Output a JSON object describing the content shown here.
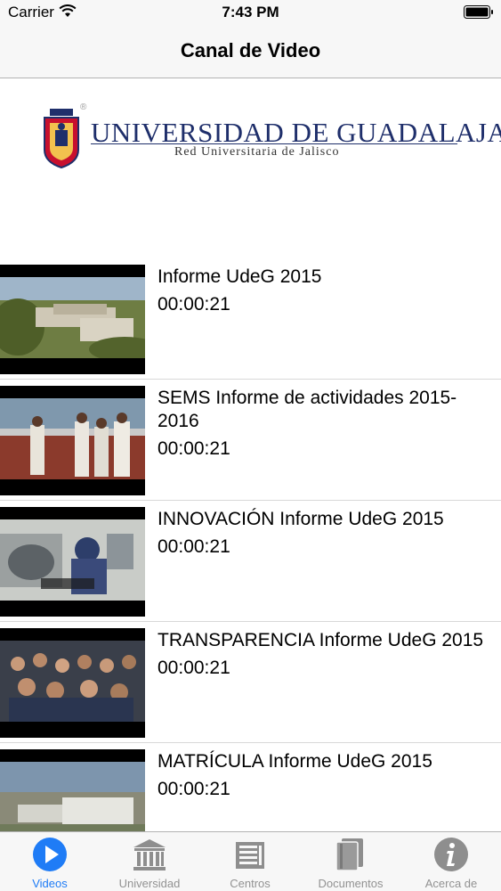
{
  "status_bar": {
    "carrier": "Carrier",
    "time": "7:43 PM"
  },
  "nav": {
    "title": "Canal de Video"
  },
  "logo": {
    "name": "Universidad de Guadalajara",
    "line1": "UNIVERSIDAD DE GUADALAJARA",
    "line2": "Red Universitaria de Jalisco",
    "registered": "®"
  },
  "videos": [
    {
      "title": "Informe UdeG 2015",
      "duration": "00:00:21",
      "thumb": "campus-aerial"
    },
    {
      "title": "SEMS  Informe de actividades 2015-2016",
      "duration": "00:00:21",
      "thumb": "people-standing"
    },
    {
      "title": "INNOVACIÓN Informe UdeG 2015",
      "duration": "00:00:21",
      "thumb": "lab-worker"
    },
    {
      "title": "TRANSPARENCIA Informe  UdeG 2015",
      "duration": "00:00:21",
      "thumb": "crowd-audience"
    },
    {
      "title": "MATRÍCULA Informe UdeG 2015",
      "duration": "00:00:21",
      "thumb": "building-aerial"
    }
  ],
  "tabbar": {
    "items": [
      {
        "label": "Videos",
        "icon": "play-icon",
        "active": true
      },
      {
        "label": "Universidad",
        "icon": "university-icon",
        "active": false
      },
      {
        "label": "Centros",
        "icon": "buildings-icon",
        "active": false
      },
      {
        "label": "Documentos",
        "icon": "books-icon",
        "active": false
      },
      {
        "label": "Acerca de",
        "icon": "info-icon",
        "active": false
      }
    ]
  },
  "colors": {
    "accent": "#1f7cf6",
    "inactive": "#929292",
    "bar_bg": "#f7f7f7",
    "logo_blue": "#1f2f6b"
  }
}
